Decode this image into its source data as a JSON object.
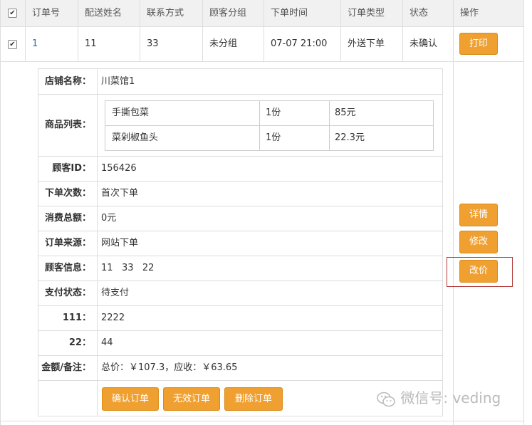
{
  "table": {
    "headers": [
      "订单号",
      "配送姓名",
      "联系方式",
      "顾客分组",
      "下单时间",
      "订单类型",
      "状态",
      "操作"
    ],
    "header_checkbox": "✔",
    "row": {
      "checkbox": "✔",
      "order_no": "1",
      "name": "11",
      "contact": "33",
      "group": "未分组",
      "time": "07-07 21:00",
      "type": "外送下单",
      "status": "未确认",
      "print_label": "打印"
    }
  },
  "detail": {
    "shop_label": "店铺名称：",
    "shop_value": "川菜馆1",
    "items_label": "商品列表：",
    "items": [
      {
        "name": "手撕包菜",
        "qty": "1份",
        "price": "85元"
      },
      {
        "name": "菜剁椒鱼头",
        "qty": "1份",
        "price": "22.3元"
      }
    ],
    "customer_id_label": "顾客ID：",
    "customer_id": "156426",
    "order_count_label": "下单次数：",
    "order_count": "首次下单",
    "total_spent_label": "消费总额：",
    "total_spent": "0元",
    "source_label": "订单来源：",
    "source": "网站下单",
    "customer_info_label": "顾客信息：",
    "customer_info": "11   33   22",
    "pay_status_label": "支付状态：",
    "pay_status": "待支付",
    "custom1_label": "111：",
    "custom1": "2222",
    "custom2_label": "22：",
    "custom2": "44",
    "amount_label": "金额/备注：",
    "amount": "总价：￥107.3，应收：￥63.65",
    "confirm_label": "确认订单",
    "invalid_label": "无效订单",
    "delete_label": "删除订单"
  },
  "actions": {
    "detail_label": "详情",
    "edit_label": "修改",
    "reprice_label": "改价"
  },
  "watermark": {
    "text": "微信号: veding"
  },
  "colors": {
    "button": "#f0a030",
    "highlight_border": "#b23a3a",
    "link": "#2a6db5"
  }
}
